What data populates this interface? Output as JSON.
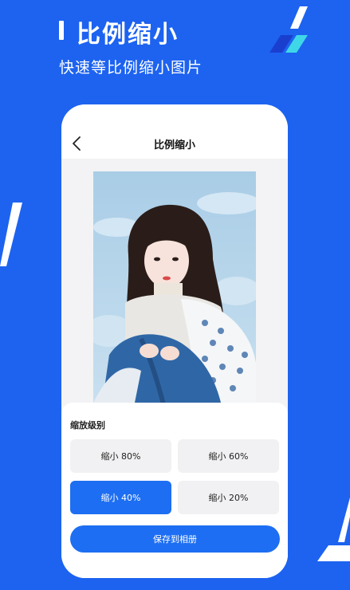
{
  "promo": {
    "title": "比例缩小",
    "subtitle": "快速等比例缩小图片"
  },
  "screen": {
    "title": "比例缩小",
    "back_icon": "chevron-left-icon",
    "preview_image": "portrait-photo"
  },
  "scale_panel": {
    "title": "缩放级别",
    "options": [
      {
        "label": "缩小 80%",
        "selected": false
      },
      {
        "label": "缩小 60%",
        "selected": false
      },
      {
        "label": "缩小 40%",
        "selected": true
      },
      {
        "label": "缩小 20%",
        "selected": false
      }
    ],
    "save_label": "保存到相册"
  },
  "colors": {
    "background": "#1d63f0",
    "accent": "#1d6ef2",
    "deco_cyan": "#3fd7e8"
  }
}
